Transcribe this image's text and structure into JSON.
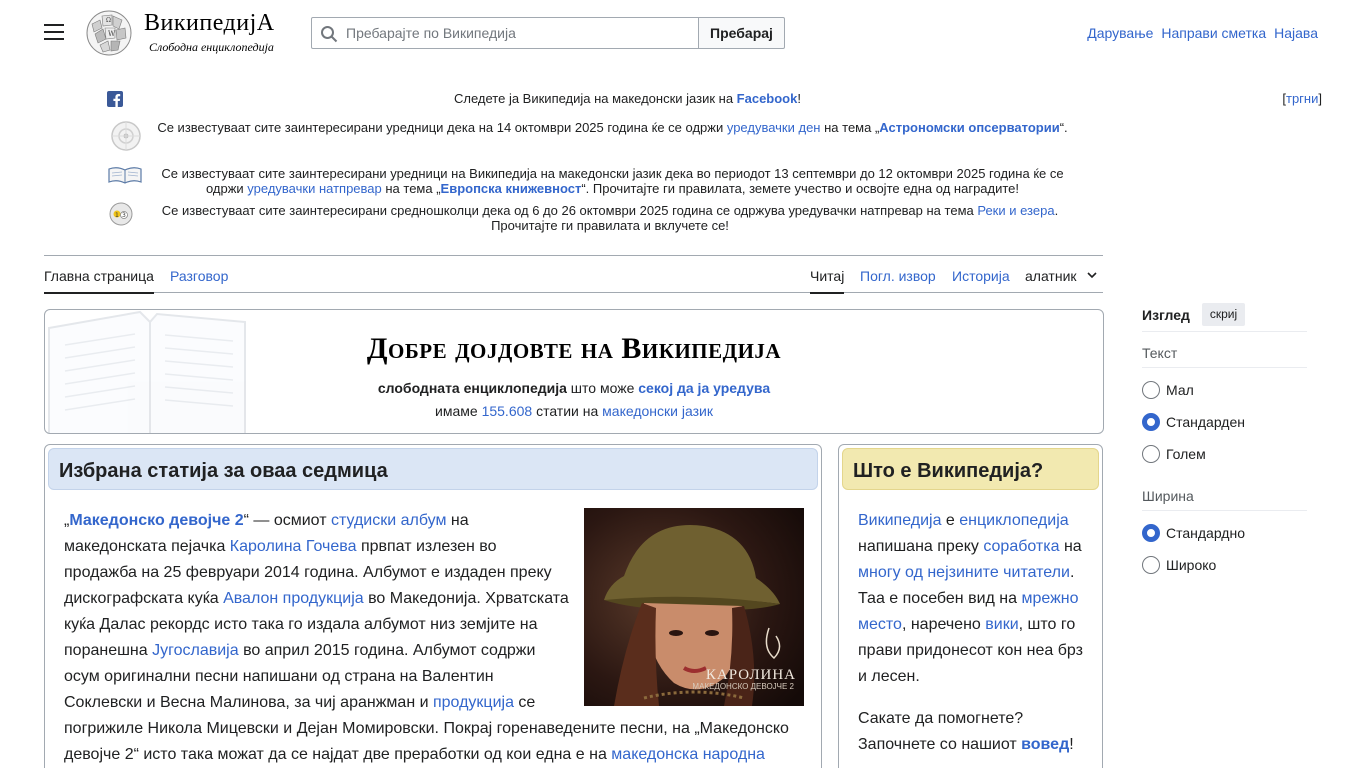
{
  "header": {
    "wordmark": "ВикипедиjA",
    "tagline": "Слободна енциклопедија",
    "search_placeholder": "Пребарајте по Википедија",
    "search_button": "Пребарај",
    "user_links": [
      "Дарување",
      "Направи сметка",
      "Најава"
    ]
  },
  "notices": {
    "dismiss_open": "[",
    "dismiss_label": "тргни",
    "dismiss_close": "]",
    "n1": {
      "text": "Следете ја Википедија на македонски јазик на ",
      "link": "Facebook",
      "end": "!"
    },
    "n2": {
      "a": "Се известуваат сите заинтересирани уредници дека на 14 октомври 2025 година ќе се одржи ",
      "link1": "уредувачки ден",
      "b": " на тема „",
      "link2": "Астрономски опсерватории",
      "c": "“."
    },
    "n3": {
      "a": "Се известуваат сите заинтересирани уредници на Википедија на македонски јазик дека во периодот 13 септември до 12 октомври 2025 година ќе се одржи ",
      "link1": "уредувачки натпревар",
      "b": " на тема „",
      "link2": "Европска книжевност",
      "c": "“. Прочитајте ги правилата, земете учество и освојте една од наградите!"
    },
    "n4": {
      "a": "Се известуваат сите заинтересирани средношколци дека од 6 до 26 октомври 2025 година се одржува уредувачки натпревар на тема ",
      "link1": "Реки и езера",
      "b": ". Прочитајте ги правилата и вклучете се!"
    }
  },
  "tabs": {
    "main_page": "Главна страница",
    "talk": "Разговор",
    "read": "Читај",
    "view_source": "Погл. извор",
    "history": "Историја",
    "tools": "алатник"
  },
  "welcome": {
    "title": "Добре дојдовте на Википедија",
    "free_encyclopedia": "слободната енциклопедија",
    "that_can": " што може ",
    "anyone_edit": "секој да ја уредува",
    "we_have": "имаме ",
    "article_count": "155.608",
    "articles_in": " статии на ",
    "language": "македонски јазик"
  },
  "featured": {
    "title": "Избрана статија за оваа седмица",
    "image_caption": "КАРОЛИНА",
    "image_subcaption": "МАКЕДОНСКО ДЕВОЈЧЕ 2",
    "p_open": "„",
    "p_title": "Македонско девојче 2",
    "p1": "“ — осмиот ",
    "l1": "студиски албум",
    "p2": " на македонската пејачка ",
    "l2": "Каролина Гочева",
    "p3": " првпат излезен во продажба на 25 февруари 2014 година. Албумот е издаден преку дискографската куќа ",
    "l3": "Авалон продукција",
    "p4": " во Македонија. Хрватската куќа Далас рекордс исто така го издала албумот низ земјите на поранешна ",
    "l4": "Југославија",
    "p5": " во април 2015 година. Албумот содржи осум оригинални песни напишани од страна на Валентин Соклевски и Весна Малинова, за чиј аранжман и ",
    "l5": "продукција",
    "p6": " се погрижиле Никола Мицевски и Дејан Момировски. Покрај горенаведените песни, на „Македонско девојче 2“ исто така можат да се најдат две преработки од кои една е на ",
    "l6": "македонска народна"
  },
  "whatis": {
    "title": "Што е Википедија?",
    "l1": "Википедија",
    "t1": " е ",
    "l2": "енциклопедија",
    "t2": " напишана преку ",
    "l3": "соработка",
    "t3": " на ",
    "l4": "многу од нејзините читатели",
    "t4": ". Таа е посебен вид на ",
    "l5": "мрежно место",
    "t5": ", наречено ",
    "l6": "вики",
    "t6": ", што го прави придонесот кон неа брз и лесен.",
    "help1": "Сакате да помогнете? Започнете со нашиот ",
    "help_link": "вовед",
    "help_end": "!"
  },
  "appearance": {
    "title": "Изглед",
    "hide": "скриј",
    "text_section": "Текст",
    "text_options": [
      "Мал",
      "Стандарден",
      "Голем"
    ],
    "text_selected": "Стандарден",
    "width_section": "Ширина",
    "width_options": [
      "Стандардно",
      "Широко"
    ],
    "width_selected": "Стандардно"
  },
  "colors": {
    "link": "#3366cc",
    "featured_header": "#dbe6f5",
    "whatis_header": "#f2e9b0",
    "border": "#a2a9b1"
  }
}
